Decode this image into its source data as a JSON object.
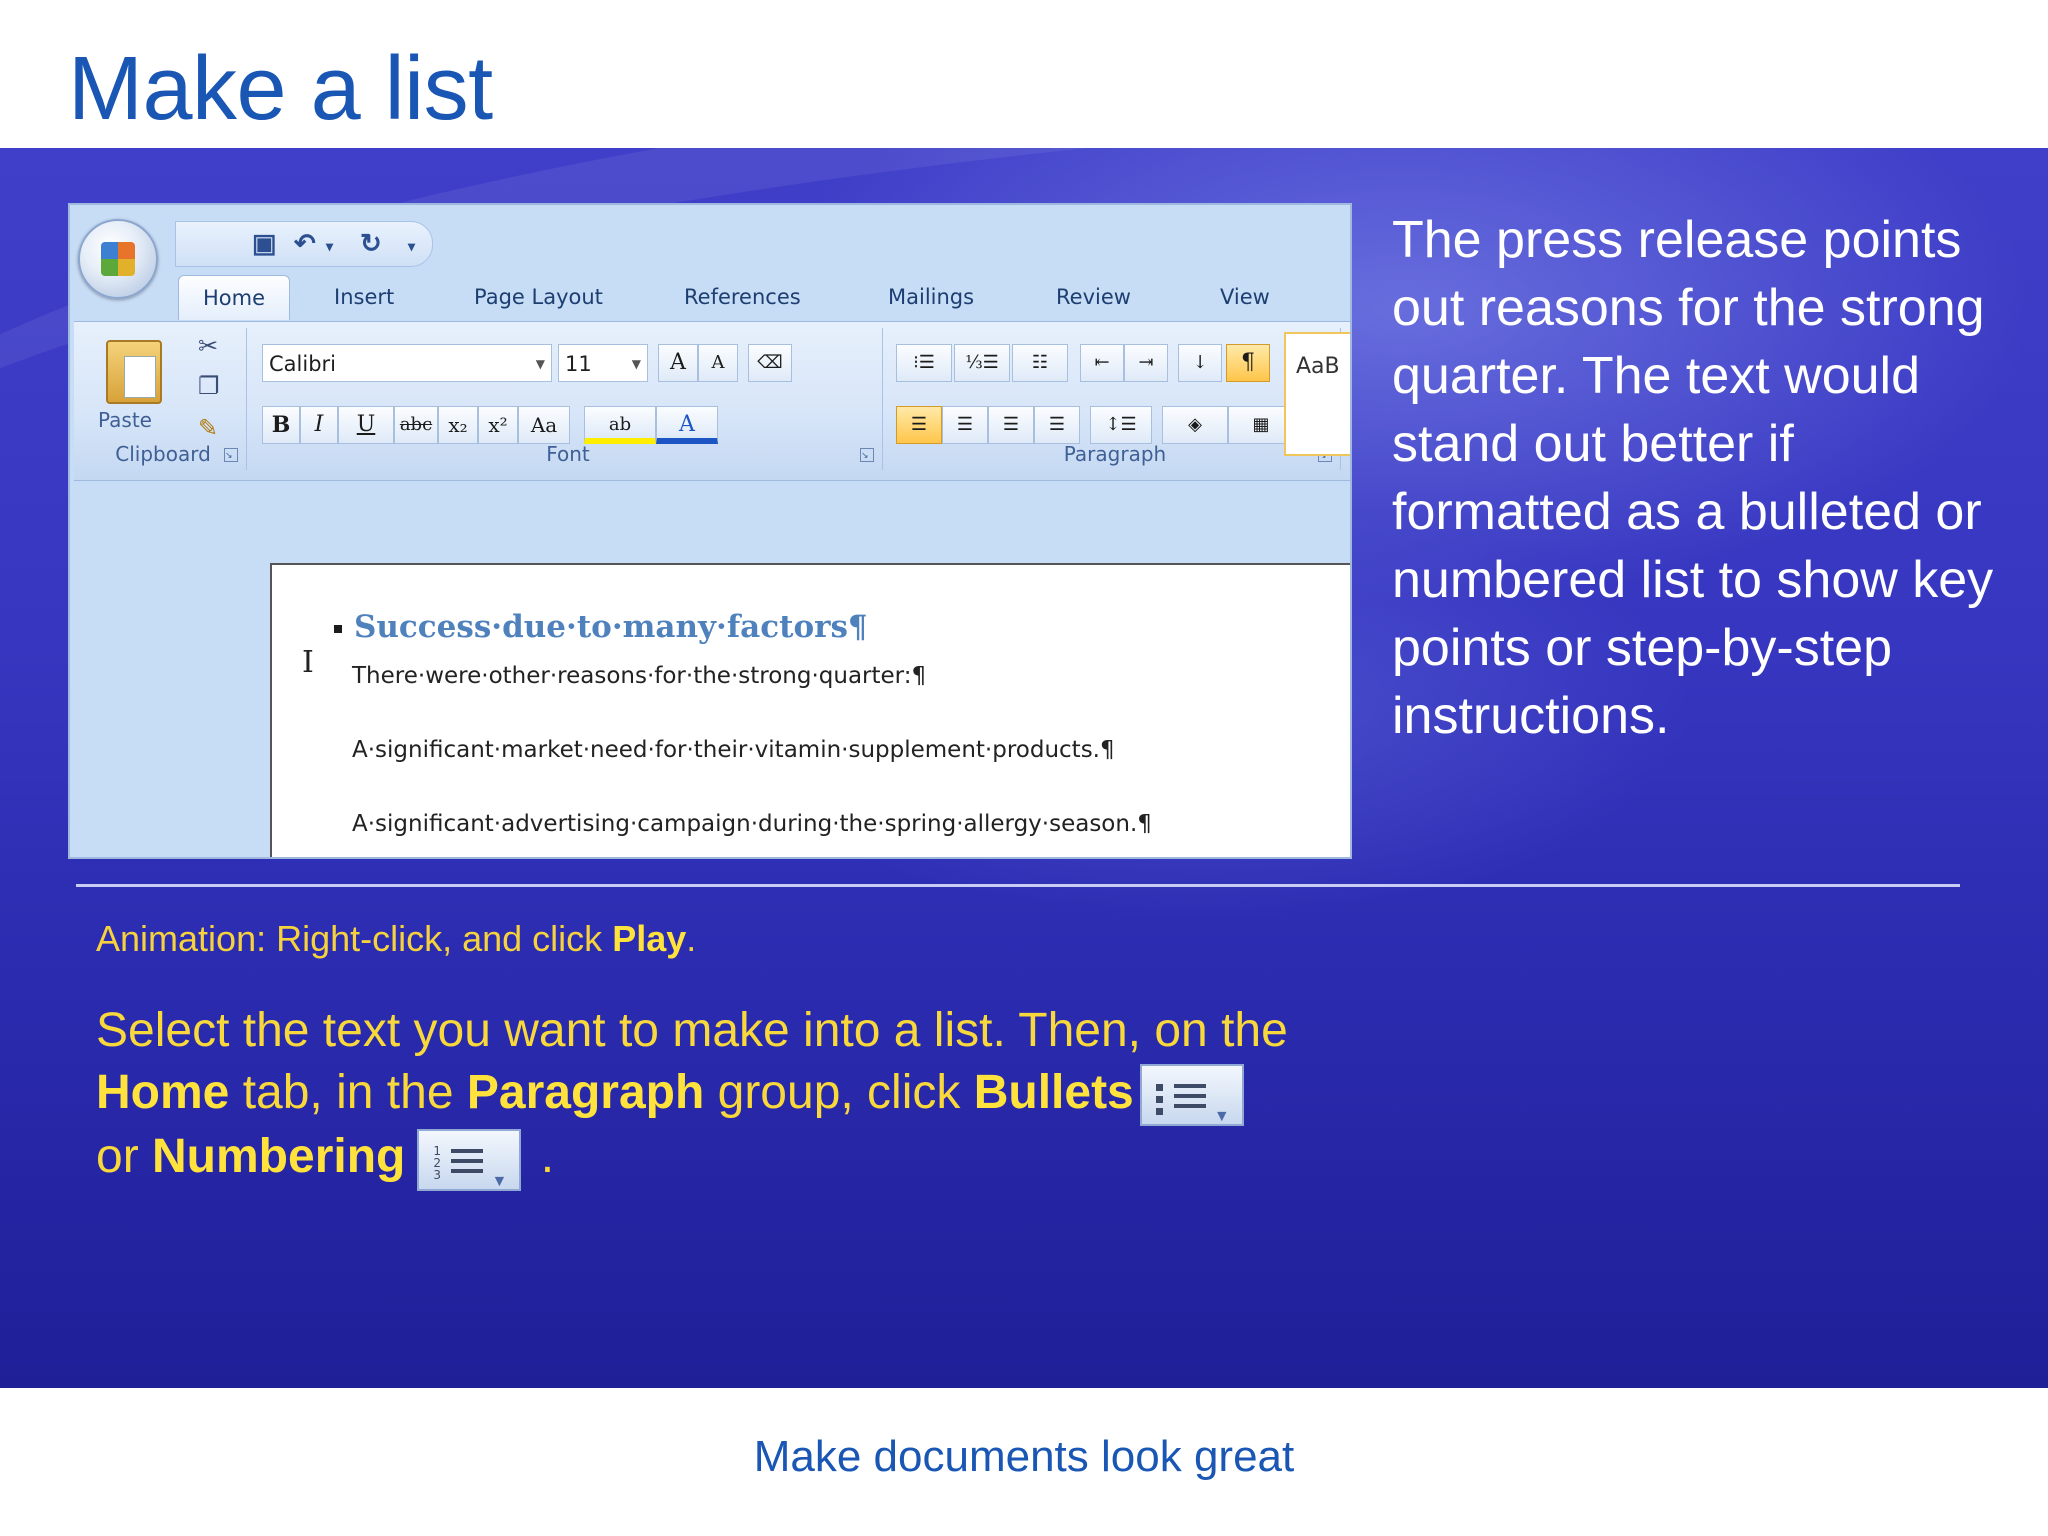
{
  "slide": {
    "title": "Make a list",
    "body_text": "The press release points out reasons for the strong quarter. The text would stand out better if formatted as a bulleted or numbered list to show key points or step-by-step instructions.",
    "animation_prefix": "Animation: Right-click, and click ",
    "animation_bold": "Play",
    "animation_suffix": ".",
    "instr_1": "Select the text you want to make into a list. Then, on the ",
    "instr_home": "Home",
    "instr_2": " tab, in the ",
    "instr_paragraph": "Paragraph",
    "instr_3": " group, click ",
    "instr_bullets": "Bullets",
    "instr_4": "or ",
    "instr_numbering": "Numbering",
    "instr_5": " .",
    "footer": "Make documents look great"
  },
  "word": {
    "tabs": [
      "Home",
      "Insert",
      "Page Layout",
      "References",
      "Mailings",
      "Review",
      "View"
    ],
    "groups": {
      "clipboard": "Clipboard",
      "font": "Font",
      "paragraph": "Paragraph"
    },
    "paste_label": "Paste",
    "font_name": "Calibri",
    "font_size": "11",
    "styles_preview": "AaB",
    "doc": {
      "heading": "Success·due·to·many·factors¶",
      "line1": "There·were·other·reasons·for·the·strong·quarter:¶",
      "line2": "A·significant·market·need·for·their·vitamin·supplement·products.¶",
      "line3": "A·significant·advertising·campaign·during·the·spring·allergy·season.¶"
    }
  },
  "colors": {
    "title_blue": "#1a56b4",
    "panel_blue": "#3636c0",
    "instruction_yellow": "#f8d83a"
  }
}
